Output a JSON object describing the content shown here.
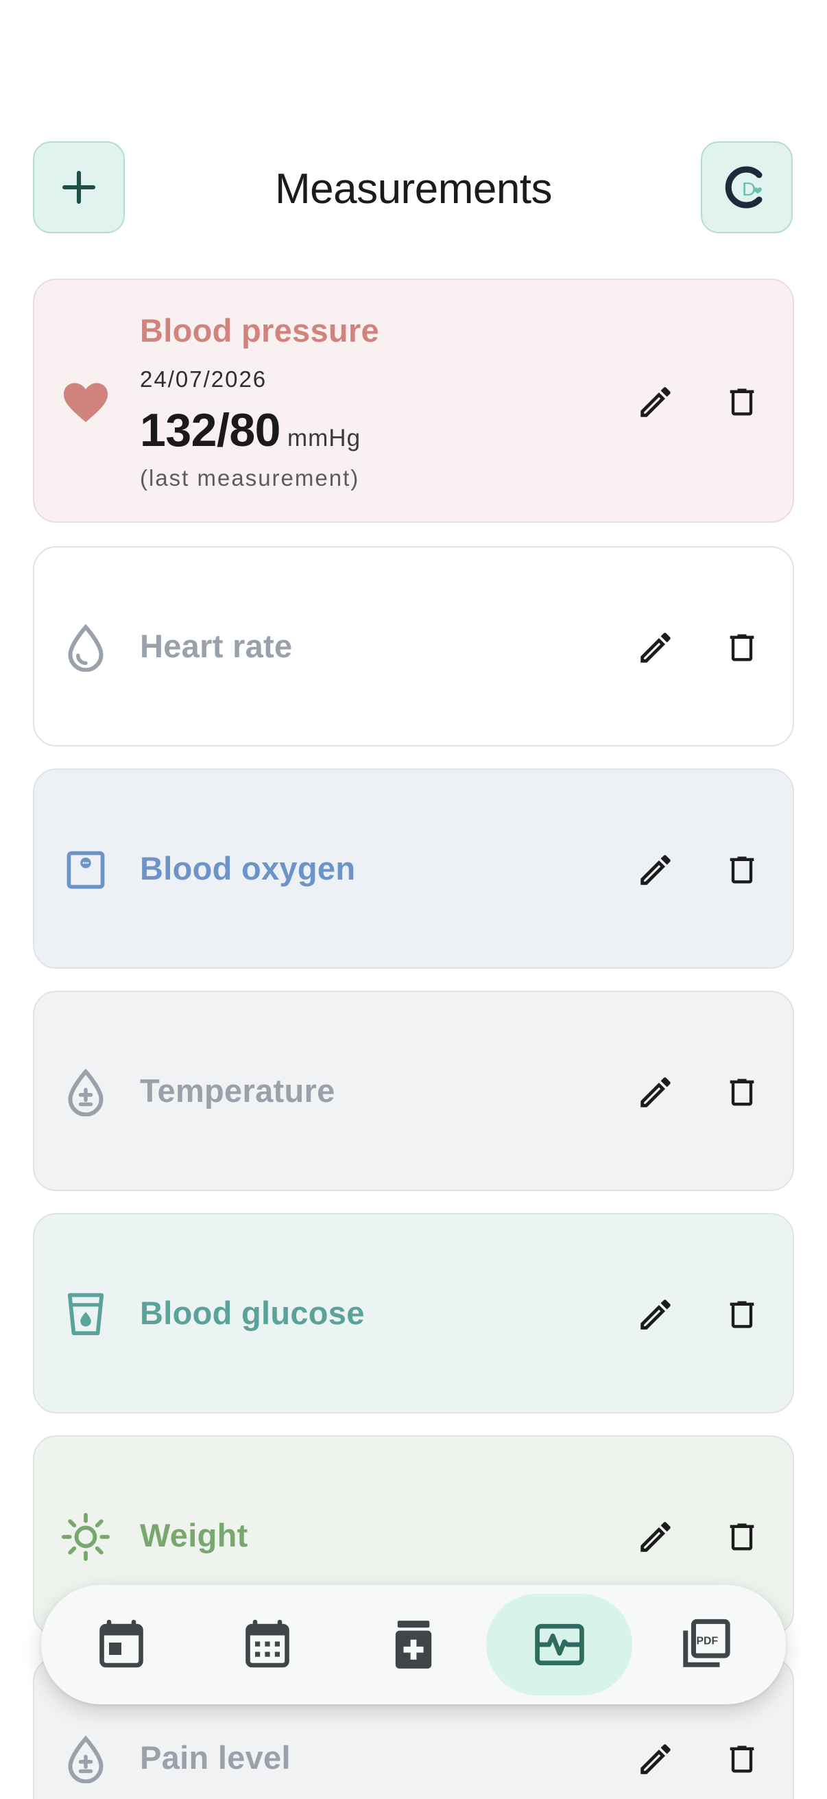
{
  "header": {
    "title": "Measurements",
    "add_icon": "plus-icon",
    "profile_icon": "app-logo-icon"
  },
  "measurements": [
    {
      "name": "Blood pressure",
      "icon": "heart-icon",
      "color": "#d1847e",
      "background": "#f8f0f1",
      "last": {
        "date": "24/07/2026",
        "value": "132/80",
        "unit": "mmHg",
        "note": "(last measurement)"
      }
    },
    {
      "name": "Heart rate",
      "icon": "drop-icon",
      "color": "#9aa1ab",
      "background": "#ffffff"
    },
    {
      "name": "Blood oxygen",
      "icon": "oximeter-icon",
      "color": "#6c94c8",
      "background": "#edf1f6"
    },
    {
      "name": "Temperature",
      "icon": "plus-minus-drop-icon",
      "color": "#9aa1ab",
      "background": "#f1f2f4"
    },
    {
      "name": "Blood glucose",
      "icon": "cup-drop-icon",
      "color": "#5aa39a",
      "background": "#ebf3f3"
    },
    {
      "name": "Weight",
      "icon": "sun-icon",
      "color": "#79a86f",
      "background": "#eef3ee"
    },
    {
      "name": "Pain level",
      "icon": "plus-minus-drop-icon",
      "color": "#9aa1ab",
      "background": "#f1f2f4"
    }
  ],
  "actions": {
    "edit_icon": "pencil-icon",
    "delete_icon": "trash-icon"
  },
  "bottom_nav": [
    {
      "icon": "calendar-day-icon",
      "active": false
    },
    {
      "icon": "calendar-month-icon",
      "active": false
    },
    {
      "icon": "medication-icon",
      "active": false
    },
    {
      "icon": "monitor-heart-icon",
      "active": true
    },
    {
      "icon": "pdf-icon",
      "active": false
    }
  ],
  "colors": {
    "accent": "#2f6b5f",
    "accent_bg": "#d7f3ea",
    "header_btn_bg": "#e1f3ef"
  }
}
